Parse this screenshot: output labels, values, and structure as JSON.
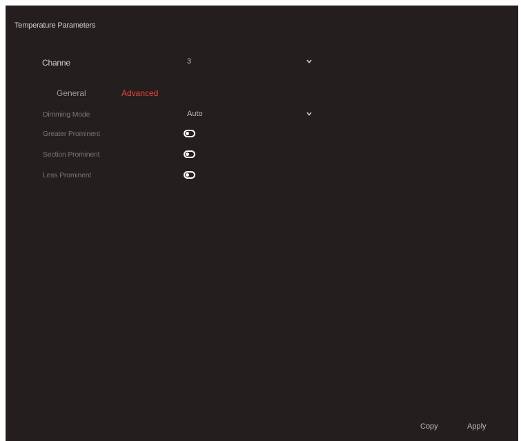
{
  "window": {
    "title": "Temperature Parameters"
  },
  "channel": {
    "label": "Channe",
    "value": "3"
  },
  "tabs": [
    {
      "label": "General",
      "active": false
    },
    {
      "label": "Advanced",
      "active": true
    }
  ],
  "settings": {
    "dimming_mode": {
      "label": "Dimming Mode",
      "value": "Auto"
    },
    "toggles": [
      {
        "label": "Greater Prominent",
        "on": false
      },
      {
        "label": "Section Prominent",
        "on": false
      },
      {
        "label": "Less Prominent",
        "on": false
      }
    ]
  },
  "footer": {
    "copy_label": "Copy",
    "apply_label": "Apply"
  },
  "colors": {
    "background": "#251e1e",
    "accent": "#e8473a",
    "text": "#bdbdbd"
  },
  "icons": {
    "dropdown": "chevron-down-icon",
    "toggle": "toggle-off-icon"
  }
}
